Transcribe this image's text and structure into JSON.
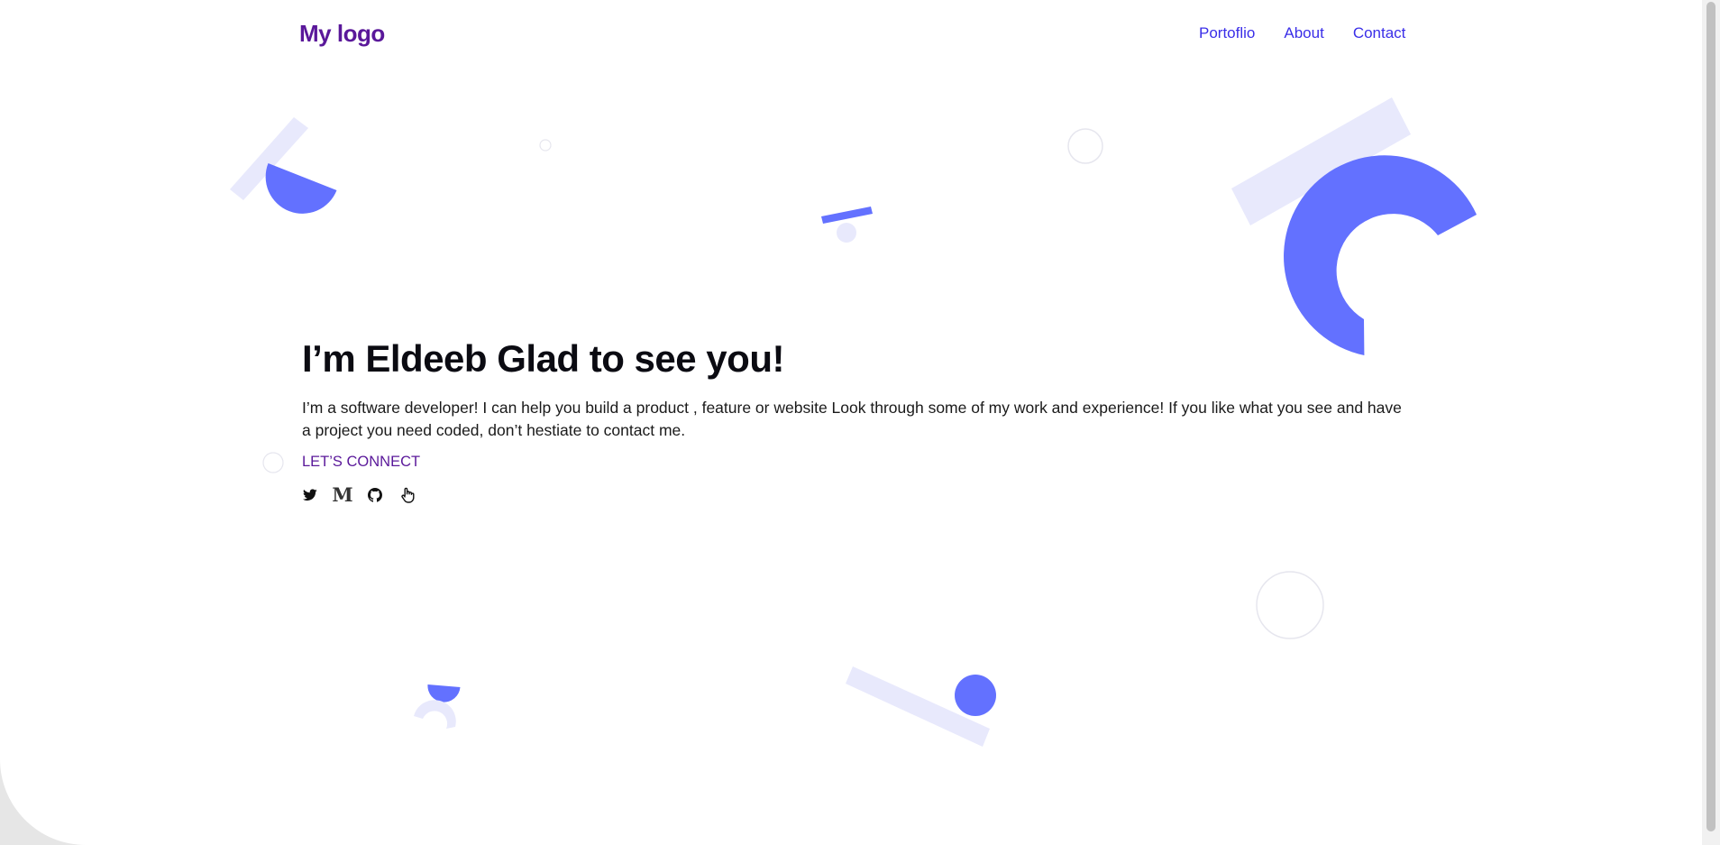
{
  "header": {
    "logo": "My logo",
    "nav": [
      "Portoflio",
      "About",
      "Contact"
    ]
  },
  "hero": {
    "title": "I’m Eldeeb Glad to see you!",
    "description": "I’m a software developer! I can help you build a product , feature or website Look through some of my work and experience! If you like what you see and have a project you need coded, don’t hestiate to contact me.",
    "cta": "LET’S CONNECT",
    "socials": [
      {
        "name": "twitter",
        "icon": "twitter-icon"
      },
      {
        "name": "medium",
        "icon": "medium-icon",
        "glyph": "M"
      },
      {
        "name": "github",
        "icon": "github-icon"
      },
      {
        "name": "touch",
        "icon": "hand-pointer-icon"
      }
    ]
  },
  "colors": {
    "brand": "#5a189a",
    "nav_link": "#3a2ee8",
    "accent": "#6371ff",
    "accent_light": "#e8e9fc",
    "text": "#0b0b12"
  }
}
